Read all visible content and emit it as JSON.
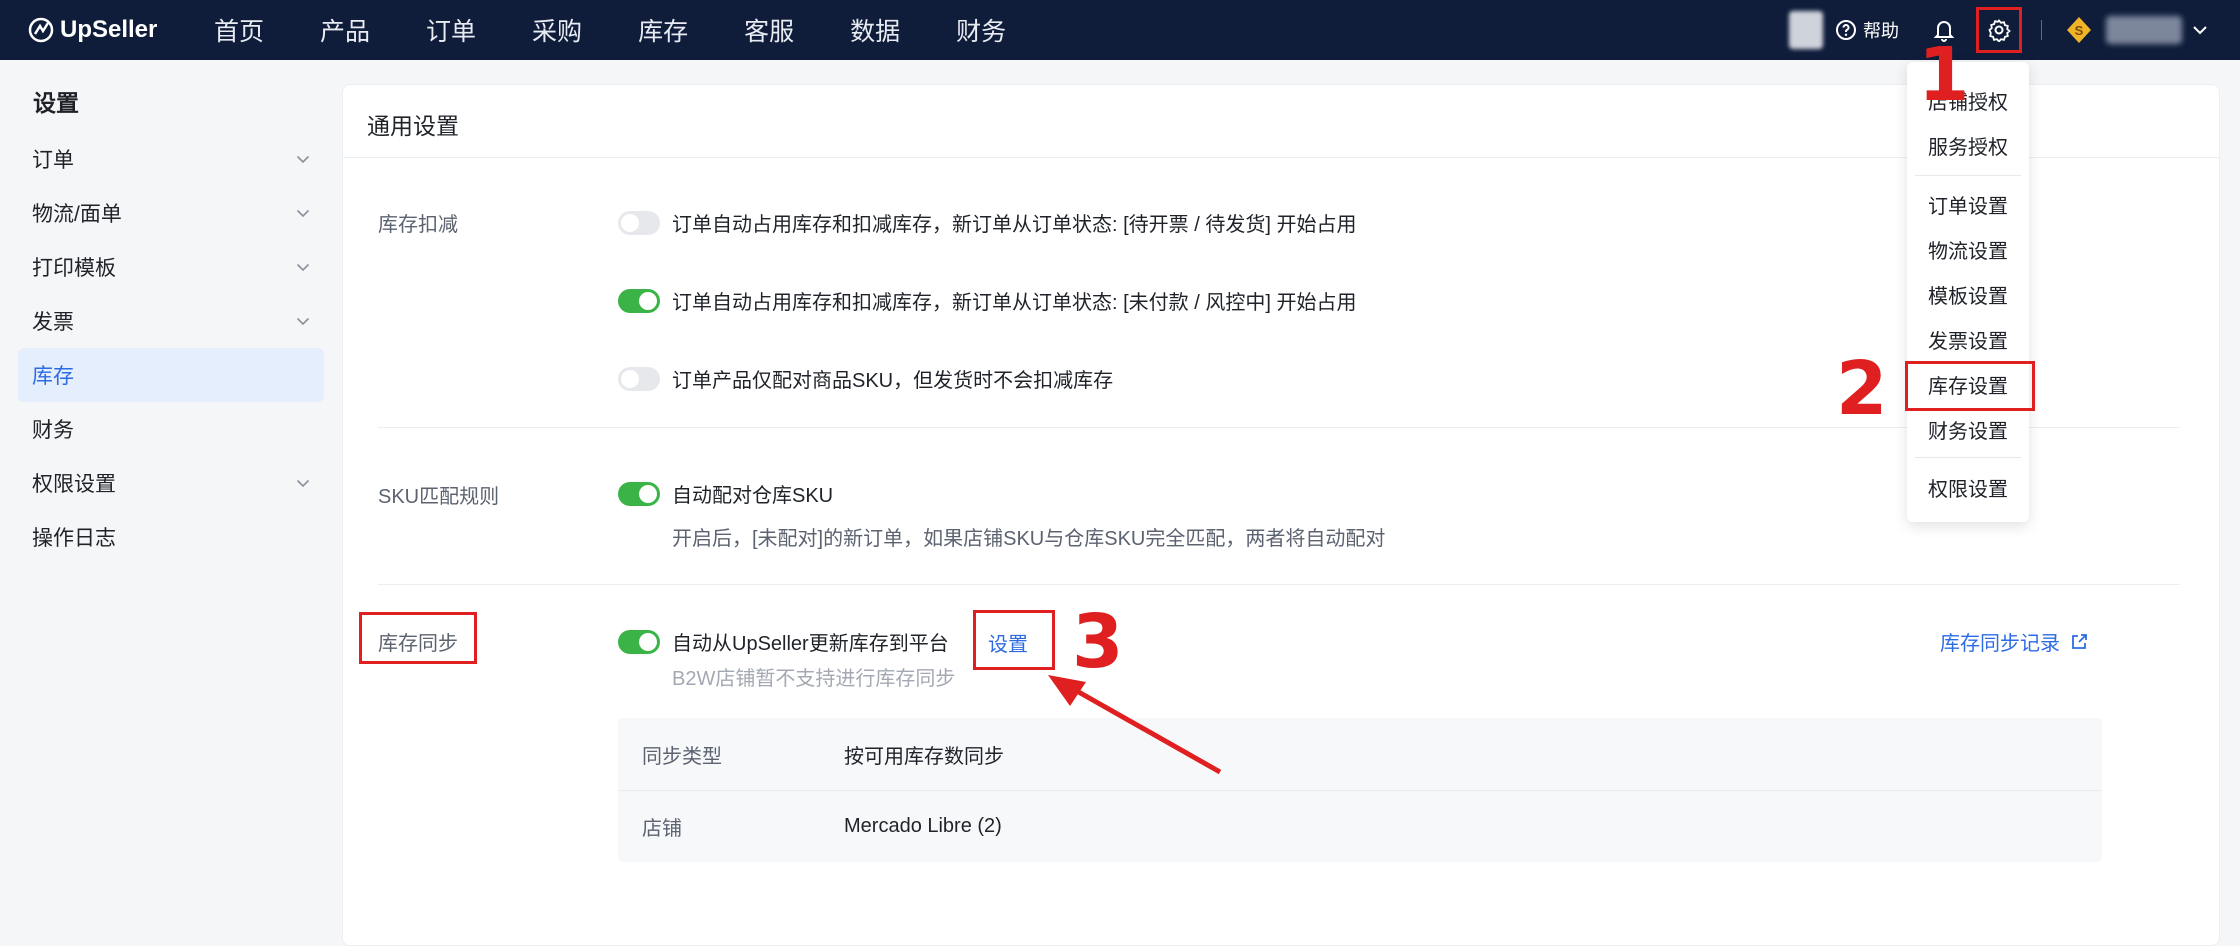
{
  "nav": {
    "brand": "UpSeller",
    "menu": [
      "首页",
      "产品",
      "订单",
      "采购",
      "库存",
      "客服",
      "数据",
      "财务"
    ],
    "help_label": "帮助"
  },
  "sidebar": {
    "title": "设置",
    "items": [
      {
        "label": "订单",
        "has_chevron": true
      },
      {
        "label": "物流/面单",
        "has_chevron": true
      },
      {
        "label": "打印模板",
        "has_chevron": true
      },
      {
        "label": "发票",
        "has_chevron": true
      },
      {
        "label": "库存",
        "has_chevron": false,
        "active": true
      },
      {
        "label": "财务",
        "has_chevron": false
      },
      {
        "label": "权限设置",
        "has_chevron": true
      },
      {
        "label": "操作日志",
        "has_chevron": false
      }
    ]
  },
  "main": {
    "title": "通用设置",
    "stock_deduction": {
      "label": "库存扣减",
      "options": [
        {
          "text": "订单自动占用库存和扣减库存，新订单从订单状态: [待开票 / 待发货] 开始占用",
          "enabled": false
        },
        {
          "text": "订单自动占用库存和扣减库存，新订单从订单状态: [未付款 / 风控中] 开始占用",
          "enabled": true
        },
        {
          "text": "订单产品仅配对商品SKU，但发货时不会扣减库存",
          "enabled": false
        }
      ]
    },
    "sku_match": {
      "label": "SKU匹配规则",
      "option": {
        "text": "自动配对仓库SKU",
        "enabled": true
      },
      "description": "开启后，[未配对]的新订单，如果店铺SKU与仓库SKU完全匹配，两者将自动配对"
    },
    "stock_sync": {
      "label": "库存同步",
      "option": {
        "text": "自动从UpSeller更新库存到平台",
        "enabled": true
      },
      "settings_link": "设置",
      "note": "B2W店铺暂不支持进行库存同步",
      "record_link": "库存同步记录",
      "table": [
        {
          "key": "同步类型",
          "value": "按可用库存数同步"
        },
        {
          "key": "店铺",
          "value": "Mercado Libre (2)"
        }
      ]
    }
  },
  "dropdown": {
    "group1": [
      "店铺授权",
      "服务授权"
    ],
    "group2": [
      "订单设置",
      "物流设置",
      "模板设置",
      "发票设置",
      "库存设置",
      "财务设置"
    ],
    "group3": [
      "权限设置"
    ]
  },
  "annotations": {
    "step1": "1",
    "step2": "2",
    "step3": "3"
  },
  "colors": {
    "nav_bg": "#0f1d3b",
    "accent": "#2d6be4",
    "toggle_on": "#3bb346",
    "highlight": "#e02020"
  }
}
